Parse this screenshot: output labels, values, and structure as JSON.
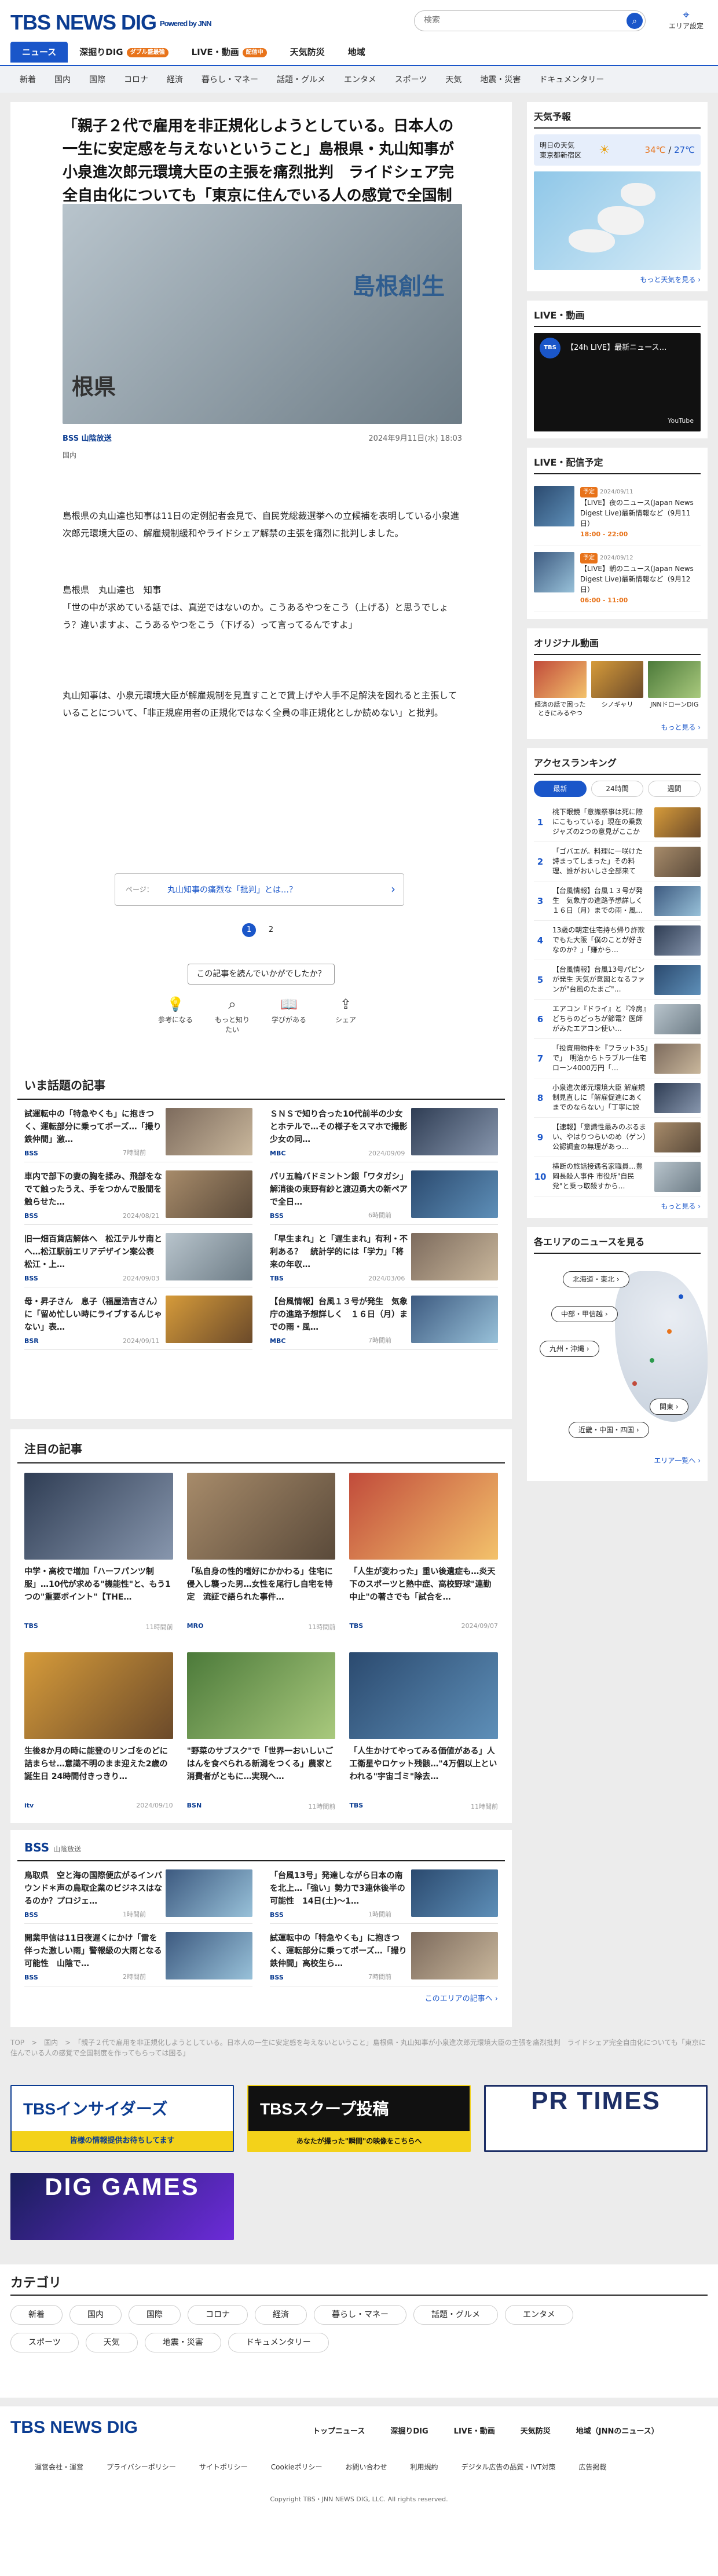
{
  "header": {
    "logo": "TBS NEWS DIG",
    "powered": "Powered by JNN",
    "search_placeholder": "検索",
    "area_label": "エリア設定",
    "tabs": [
      {
        "label": "ニュース",
        "badge": ""
      },
      {
        "label": "深掘りDIG",
        "badge": "ダブル盛最強"
      },
      {
        "label": "LIVE・動画",
        "badge": "配信中"
      },
      {
        "label": "天気防災",
        "badge": ""
      },
      {
        "label": "地域",
        "badge": ""
      }
    ],
    "categories": [
      "新着",
      "国内",
      "国際",
      "コロナ",
      "経済",
      "暮らし・マネー",
      "話題・グルメ",
      "エンタメ",
      "スポーツ",
      "天気",
      "地震・災害",
      "ドキュメンタリー"
    ]
  },
  "article": {
    "headline": "「親子２代で雇用を非正規化しようとしている。日本人の一生に安定感を与えないということ」島根県・丸山知事が小泉進次郎元環境大臣の主張を痛烈批判　ライドシェア完全自由化についても「東京に住んでいる人の感覚で全国制度を作ってもら…",
    "hero_sign1": "島根創生",
    "hero_sign2": "根県",
    "source": "BSS 山陰放送",
    "date": "2024年9月11日(水) 18:03",
    "tag": "国内",
    "p1": "島根県の丸山達也知事は11日の定例記者会見で、自民党総裁選挙への立候補を表明している小泉進次郎元環境大臣の、解雇規制緩和やライドシェア解禁の主張を痛烈に批判しました。",
    "p2": "島根県　丸山達也　知事\n「世の中が求めている話では、真逆ではないのか。こうあるやつをこう（上げる）と思うでしょう？違いますよ、こうあるやつをこう（下げる）って言ってるんですよ」",
    "p3": "丸山知事は、小泉元環境大臣が解雇規制を見直すことで賃上げや人手不足解決を図れると主張していることについて、「非正規雇用者の正規化ではなく全員の非正規化としか読めない」と批判。",
    "related_label": "ページ：",
    "related_text": "丸山知事の痛烈な「批判」とは…？",
    "pages": [
      "1",
      "2"
    ],
    "survey": "この記事を読んでいかがでしたか？",
    "reactions": [
      {
        "label": "参考になる",
        "icon": "bulb-icon"
      },
      {
        "label": "もっと知りたい",
        "icon": "search-icon"
      },
      {
        "label": "学びがある",
        "icon": "book-icon"
      },
      {
        "label": "シェア",
        "icon": "share-icon"
      }
    ]
  },
  "trending": {
    "title": "いま話題の記事",
    "items": [
      {
        "title": "試運転中の「特急やくも」に抱きつく、運転部分に乗ってポーズ…「撮り鉄仲間」激…",
        "src": "BSS",
        "time": "7時間前"
      },
      {
        "title": "ＳＮＳで知り合った10代前半の少女とホテルで…その様子をスマホで撮影　少女の同…",
        "src": "MBC",
        "time": "2024/09/09"
      },
      {
        "title": "車内で部下の妻の胸を揉み、飛部をなでて触ったうえ、手をつかんで股間を触らせた…",
        "src": "BSS",
        "time": "2024/08/21"
      },
      {
        "title": "パリ五輪バドミントン銀「ワタガシ」解消後の東野有紗と渡辺勇大の新ペアで全日…",
        "src": "BSS",
        "time": "6時間前"
      },
      {
        "title": "旧一畑百貨店解体へ　松江テルサ南とへ…松江駅前エリアデザイン案公表　松江・上…",
        "src": "BSS",
        "time": "2024/09/03"
      },
      {
        "title": "「早生まれ」と「遅生まれ」有利・不利ある？　統計学的には「学力」「将来の年収…",
        "src": "TBS",
        "time": "2024/03/06"
      },
      {
        "title": "母・昇子さん　息子（福屋浩吉さん）に「留め忙しい時にライブするんじゃない」表…",
        "src": "BSR",
        "time": "2024/09/11"
      },
      {
        "title": "【台風情報】台風１３号が発生　気象庁の進路予想詳しく　１６日（月）までの雨・風…",
        "src": "MBC",
        "time": "7時間前"
      }
    ]
  },
  "featured": {
    "title": "注目の記事",
    "items": [
      {
        "title": "中学・高校で増加「ハーフパンツ制服」…10代が求める\"機能性\"と、もう1つの\"重要ポイント\"【THE…",
        "src": "TBS",
        "time": "11時間前"
      },
      {
        "title": "「私自身の性的嗜好にかかわる」住宅に侵入し襲った男…女性を尾行し自宅を特定　流証で語られた事件…",
        "src": "MRO",
        "time": "11時間前"
      },
      {
        "title": "「人生が変わった」重い後遺症も…炎天下のスポーツと熱中症、高校野球\"連勤中止\"の著さでも「試合を…",
        "src": "TBS",
        "time": "2024/09/07"
      },
      {
        "title": "生後8か月の時に能登のリンゴをのどに詰まらせ…意識不明のまま迎えた2歳の誕生日 24時間付きっきり…",
        "src": "itv",
        "time": "2024/09/10"
      },
      {
        "title": "\"野菜のサブスク\"で「世界一おいしいごはんを食べられる新潟をつくる」農家と消費者がともに…実現へ…",
        "src": "BSN",
        "time": "11時間前"
      },
      {
        "title": "「人生かけてやってみる価値がある」人工衛星やロケット残骸…\"4万個以上といわれる\"宇宙ゴミ\"除去…",
        "src": "TBS",
        "time": "11時間前"
      }
    ]
  },
  "local": {
    "station": "BSS",
    "station_name": "山陰放送",
    "items": [
      {
        "title": "鳥取県　空と海の国際便広がるインバウンド＊声の鳥取企業のビジネスはなるのか？プロジェ…",
        "src": "BSS",
        "time": "1時間前"
      },
      {
        "title": "「台風13号」発達しながら日本の南を北上…「強い」勢力で3連休後半の可能性　14日(土)〜1…",
        "src": "BSS",
        "time": "1時間前"
      },
      {
        "title": "開業甲信は11日夜遅くにかけ「雷を伴った激しい雨」警報級の大雨となる可能性　山陰で…",
        "src": "BSS",
        "time": "2時間前"
      },
      {
        "title": "試運転中の「特急やくも」に抱きつく、運転部分に乗ってポーズ…「撮り鉄仲間」高校生ら…",
        "src": "BSS",
        "time": "7時間前"
      }
    ],
    "more": "このエリアの記事へ ›"
  },
  "sidebar": {
    "weather": {
      "title": "天気予報",
      "label1": "明日の天気",
      "label2": "東京都新宿区",
      "icon": "sun-cloud-icon",
      "high": "34℃",
      "low": "27℃",
      "more": "もっと天気を見る ›"
    },
    "live": {
      "title": "LIVE・動画",
      "video_title": "【24h LIVE】最新ニュース…",
      "video_brand": "TBS NEWS DIG",
      "platform": "YouTube"
    },
    "live_schedule": {
      "title": "LIVE・配信予定",
      "items": [
        {
          "badge": "予定",
          "date": "2024/09/11",
          "title": "【LIVE】夜のニュース(Japan News Digest Live)最新情報など（9月11日）",
          "time": "18:00 - 22:00"
        },
        {
          "badge": "予定",
          "date": "2024/09/12",
          "title": "【LIVE】朝のニュース(Japan News Digest Live)最新情報など（9月12日）",
          "time": "06:00 - 11:00"
        }
      ]
    },
    "original": {
      "title": "オリジナル動画",
      "items": [
        "経済の話で困ったときにみるやつ",
        "シノギャリ",
        "JNNドローンDIG"
      ],
      "more": "もっと見る ›"
    },
    "ranking": {
      "title": "アクセスランキング",
      "tabs": [
        "最新",
        "24時間",
        "週間"
      ],
      "items": [
        "桃下眼鏡「意識祭事は死に際にこもっている」現在の乗数ジャズの2つの意見がここから…",
        "「ゴバエが。料理に一咲けた詩まってしまった」その料理、誰がおいしさ全部来てる？",
        "【台風情報】台風１３号が発生　気象庁の進路予想詳しく１６日（月）までの雨・風…",
        "13歳の朝定住宅持ち帰り詐欺でもた大阪「僕のことが好きなのか？」「嫌から…",
        "【台風情報】台風13号パピンが発生 天気が意図となるファンが\"台風のたまご\"…",
        "エアコン『ドライ』と『冷房』どちらのどっちが節電？医師がみたエアコン使い…",
        "「投資用物件を『フラット35』で」　明治からトラブル一住宅ローン4000万円「…",
        "小泉進次郎元環境大臣 解雇規制見直しに「解雇促進にあくまでのならない」「丁寧に説明…",
        "【速報】「意識性最みのぶるまい、やはりつらいのめ（ゲン）公認調査の無理があっ…",
        "横断の旅話接遇名家職員…豊岡長殺人事件 市役所\"自民党\"と乗っ取殺すから…"
      ],
      "more": "もっと見る ›"
    },
    "areas": {
      "title": "各エリアのニュースを見る",
      "buttons": [
        "北海道・東北 ›",
        "中部・甲信越 ›",
        "九州・沖縄 ›",
        "関東 ›",
        "近畿・中国・四国 ›"
      ],
      "more": "エリア一覧へ ›"
    }
  },
  "breadcrumb": "TOP　>　国内　>　「親子２代で雇用を非正規化しようとしている。日本人の一生に安定感を与えないということ」島根県・丸山知事が小泉進次郎元環境大臣の主張を痛烈批判　ライドシェア完全自由化についても「東京に住んでいる人の感覚で全国制度を作ってもらっては困る」",
  "banners": {
    "insiders": "TBSインサイダーズ",
    "insiders_sub": "皆様の情報提供お待ちしてます",
    "scoop": "TBSスクープ投稿",
    "scoop_sub": "あなたが撮った\"瞬間\"の映像をこちらへ",
    "prtimes": "PR TIMES",
    "dig_games": "DIG GAMES"
  },
  "categories_section": {
    "title": "カテゴリ",
    "items": [
      "新着",
      "国内",
      "国際",
      "コロナ",
      "経済",
      "暮らし・マネー",
      "話題・グルメ",
      "エンタメ",
      "スポーツ",
      "天気",
      "地震・災害",
      "ドキュメンタリー"
    ]
  },
  "footer": {
    "logo": "TBS NEWS DIG",
    "nav1": [
      "トップニュース",
      "深掘りDIG",
      "LIVE・動画",
      "天気防災",
      "地域（JNNのニュース）"
    ],
    "nav2": [
      "運営会社・運営",
      "プライバシーポリシー",
      "サイトポリシー",
      "Cookieポリシー",
      "お問い合わせ",
      "利用規約",
      "デジタル広告の品質・IVT対策",
      "広告掲載"
    ],
    "copyright": "Copyright TBS・JNN NEWS DIG, LLC. All rights reserved."
  }
}
